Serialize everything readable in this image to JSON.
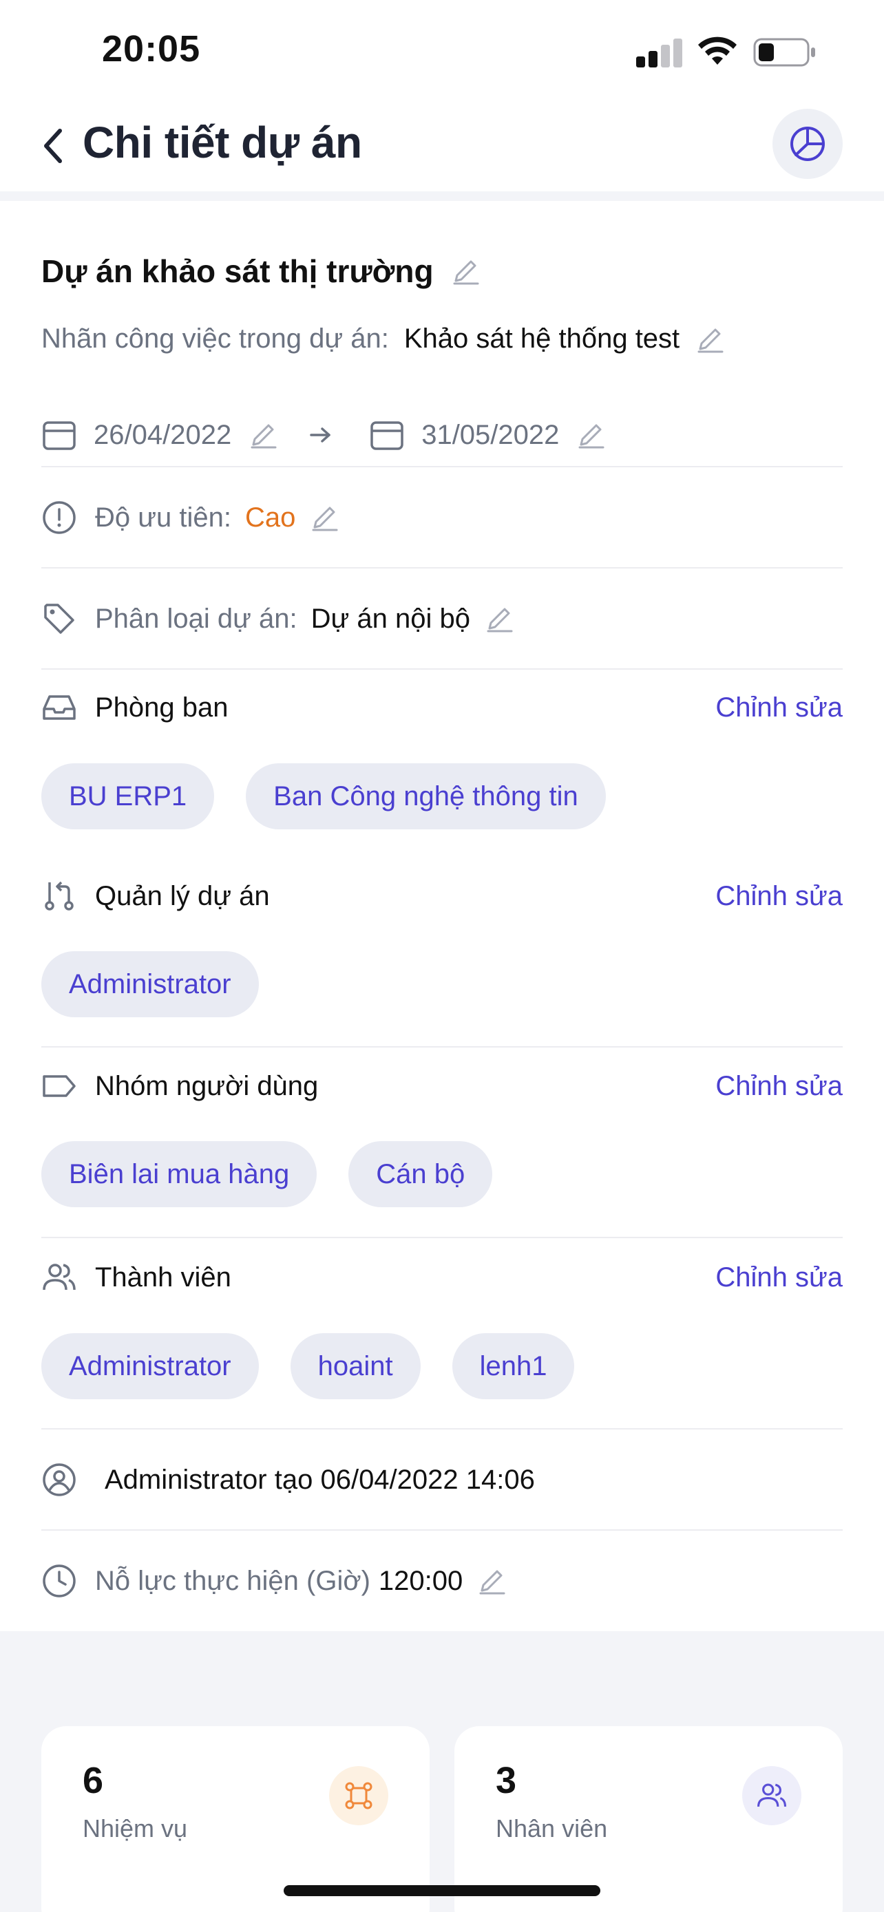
{
  "status_bar": {
    "time": "20:05"
  },
  "header": {
    "title": "Chi tiết dự án",
    "back_icon": "chevron-left-icon",
    "chart_icon": "pie-chart-icon"
  },
  "project": {
    "name": "Dự án khảo sát thị trường",
    "task_label_caption": "Nhãn công việc trong dự án:",
    "task_label_value": "Khảo sát hệ thống test",
    "start_date": "26/04/2022",
    "end_date": "31/05/2022",
    "priority_caption": "Độ ưu tiên:",
    "priority_value": "Cao",
    "category_caption": "Phân loại dự án:",
    "category_value": "Dự án nội bộ"
  },
  "sections": {
    "edit_label": "Chỉnh sửa",
    "departments": {
      "title": "Phòng ban",
      "chips": [
        "BU ERP1",
        "Ban Công nghệ thông tin"
      ]
    },
    "managers": {
      "title": "Quản lý dự án",
      "chips": [
        "Administrator"
      ]
    },
    "user_groups": {
      "title": "Nhóm người dùng",
      "chips": [
        "Biên lai mua hàng",
        "Cán bộ"
      ]
    },
    "members": {
      "title": "Thành viên",
      "chips": [
        "Administrator",
        "hoaint",
        "lenh1"
      ]
    }
  },
  "created_by": "Administrator tạo 06/04/2022 14:06",
  "effort": {
    "caption": "Nỗ lực thực hiện (Giờ)",
    "value": "120:00"
  },
  "stats": [
    {
      "count": "6",
      "label": "Nhiệm vụ",
      "icon": "tasks-icon",
      "icon_color": "#f0883a",
      "icon_bg": "#fdf1e2"
    },
    {
      "count": "3",
      "label": "Nhân viên",
      "icon": "users-icon",
      "icon_color": "#5a4fd6",
      "icon_bg": "#eeeefa"
    }
  ],
  "colors": {
    "accent": "#4a3fd0",
    "priority_high": "#e2731d",
    "muted": "#6b7280"
  }
}
